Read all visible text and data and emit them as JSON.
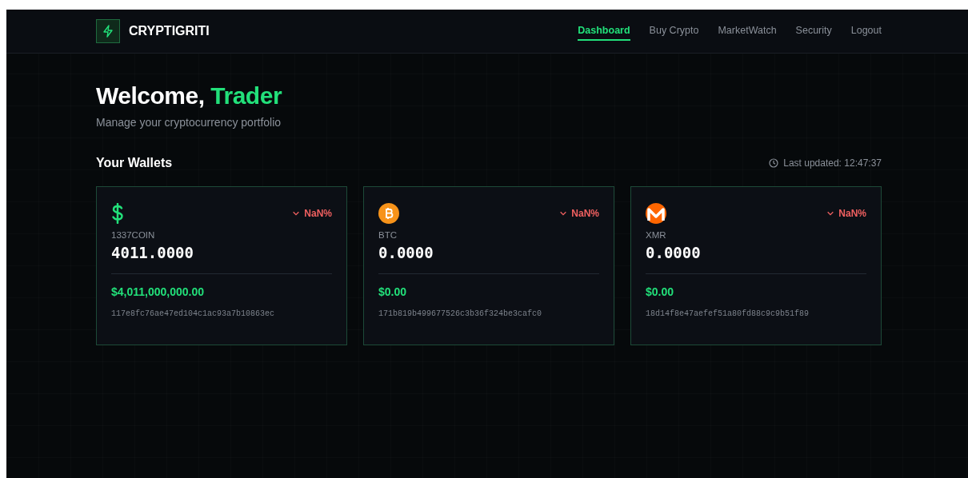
{
  "brand": {
    "name": "CRYPTIGRITI"
  },
  "nav": [
    {
      "label": "Dashboard",
      "selected": true
    },
    {
      "label": "Buy Crypto",
      "selected": false
    },
    {
      "label": "MarketWatch",
      "selected": false
    },
    {
      "label": "Security",
      "selected": false
    },
    {
      "label": "Logout",
      "selected": false
    }
  ],
  "welcome": {
    "greeting": "Welcome,",
    "name": "Trader",
    "subtitle": "Manage your cryptocurrency portfolio"
  },
  "wallets_header": {
    "title": "Your Wallets",
    "last_updated": "Last updated: 12:47:37"
  },
  "wallets": [
    {
      "kind": "usd",
      "symbol": "1337COIN",
      "balance": "4011.0000",
      "value": "$4,011,000,000.00",
      "address": "117e8fc76ae47ed104c1ac93a7b10863ec",
      "change": "NaN%",
      "falling": true
    },
    {
      "kind": "btc",
      "symbol": "BTC",
      "balance": "0.0000",
      "value": "$0.00",
      "address": "171b819b499677526c3b36f324be3cafc0",
      "change": "NaN%",
      "falling": true
    },
    {
      "kind": "xmr",
      "symbol": "XMR",
      "balance": "0.0000",
      "value": "$0.00",
      "address": "18d14f8e47aefef51a80fd88c9c9b51f89",
      "change": "NaN%",
      "falling": true
    }
  ]
}
